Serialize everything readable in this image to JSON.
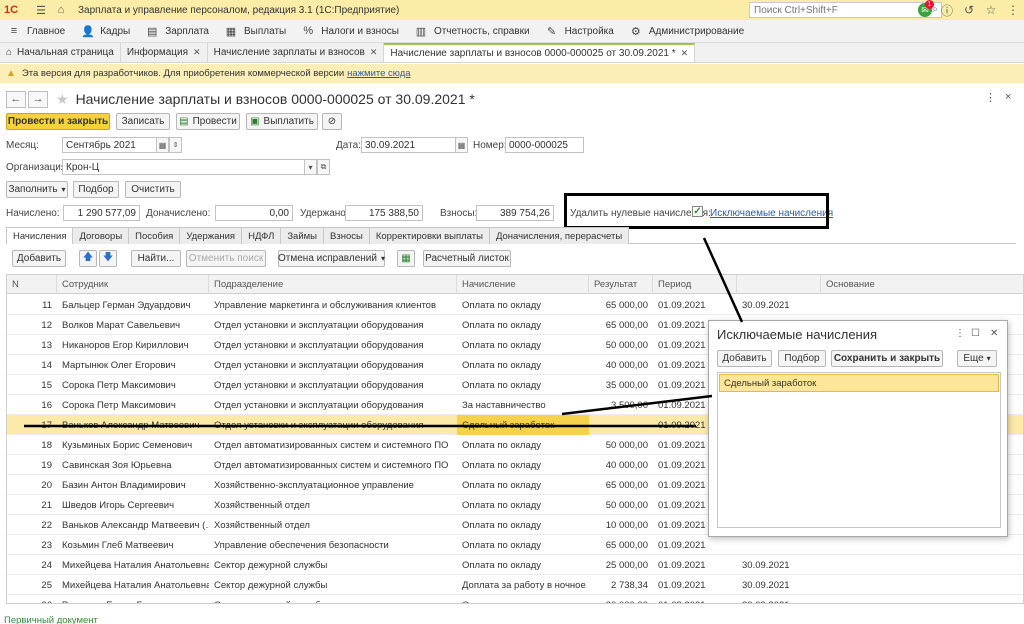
{
  "titlebar": {
    "logo": "1С",
    "app_title": "Зарплата и управление персоналом, редакция 3.1  (1С:Предприятие)",
    "search_placeholder": "Поиск Ctrl+Shift+F",
    "notif_count": "1"
  },
  "main_menu": [
    {
      "icon": "≡",
      "label": "Главное"
    },
    {
      "icon": "👤",
      "label": "Кадры"
    },
    {
      "icon": "▤",
      "label": "Зарплата"
    },
    {
      "icon": "▦",
      "label": "Выплаты"
    },
    {
      "icon": "%",
      "label": "Налоги и взносы"
    },
    {
      "icon": "▥",
      "label": "Отчетность, справки"
    },
    {
      "icon": "✎",
      "label": "Настройка"
    },
    {
      "icon": "⚙",
      "label": "Администрирование"
    }
  ],
  "open_tabs": [
    {
      "label": "Начальная страница"
    },
    {
      "label": "Информация"
    },
    {
      "label": "Начисление зарплаты и взносов"
    },
    {
      "label": "Начисление зарплаты и взносов 0000-000025 от 30.09.2021 *"
    }
  ],
  "banner": {
    "text": "Эта версия для разработчиков. Для приобретения коммерческой версии",
    "link": "нажмите сюда"
  },
  "document": {
    "title": "Начисление зарплаты и взносов 0000-000025 от 30.09.2021 *",
    "more": "⋮",
    "close": "×"
  },
  "toolbar": {
    "post_close": "Провести и закрыть",
    "save": "Записать",
    "post": "Провести",
    "pay": "Выплатить"
  },
  "form": {
    "month_label": "Месяц:",
    "month_value": "Сентябрь 2021",
    "date_label": "Дата:",
    "date_value": "30.09.2021",
    "number_label": "Номер:",
    "number_value": "0000-000025",
    "org_label": "Организация:",
    "org_value": "Крон-Ц",
    "fill_btn": "Заполнить",
    "select_btn": "Подбор",
    "clear_btn": "Очистить"
  },
  "totals": {
    "accrued_label": "Начислено:",
    "accrued_value": "1 290 577,09",
    "extra_label": "Доначислено:",
    "extra_value": "0,00",
    "withheld_label": "Удержано:",
    "withheld_value": "175 388,50",
    "contrib_label": "Взносы:",
    "contrib_value": "389 754,26",
    "delete_zero_label": "Удалить нулевые начисления:",
    "excluded_link": "Исключаемые начисления"
  },
  "section_tabs": [
    "Начисления",
    "Договоры",
    "Пособия",
    "Удержания",
    "НДФЛ",
    "Займы",
    "Взносы",
    "Корректировки выплаты",
    "Доначисления, перерасчеты"
  ],
  "grid_toolbar": {
    "add": "Добавить",
    "find": "Найти...",
    "cancel_find": "Отменить поиск",
    "cancel_fix": "Отмена исправлений",
    "payslip": "Расчетный листок"
  },
  "grid": {
    "columns": [
      "N",
      "Сотрудник",
      "Подразделение",
      "Начисление",
      "Результат",
      "Период",
      "",
      "Основание"
    ],
    "rows": [
      {
        "n": "11",
        "emp": "Бальцер Герман Эдуардович",
        "dept": "Управление маркетинга и обслуживания клиентов",
        "acc": "Оплата по окладу",
        "res": "65 000,00",
        "period": "01.09.2021",
        "end": "30.09.2021"
      },
      {
        "n": "12",
        "emp": "Волков Марат Савельевич",
        "dept": "Отдел установки и эксплуатации оборудования",
        "acc": "Оплата по окладу",
        "res": "65 000,00",
        "period": "01.09.2021",
        "end": ""
      },
      {
        "n": "13",
        "emp": "Никаноров Егор Кириллович",
        "dept": "Отдел установки и эксплуатации оборудования",
        "acc": "Оплата по окладу",
        "res": "50 000,00",
        "period": "01.09.2021",
        "end": ""
      },
      {
        "n": "14",
        "emp": "Мартынюк Олег Егорович",
        "dept": "Отдел установки и эксплуатации оборудования",
        "acc": "Оплата по окладу",
        "res": "40 000,00",
        "period": "01.09.2021",
        "end": ""
      },
      {
        "n": "15",
        "emp": "Сорока Петр Максимович",
        "dept": "Отдел установки и эксплуатации оборудования",
        "acc": "Оплата по окладу",
        "res": "35 000,00",
        "period": "01.09.2021",
        "end": ""
      },
      {
        "n": "16",
        "emp": "Сорока Петр Максимович",
        "dept": "Отдел установки и эксплуатации оборудования",
        "acc": "За наставничество",
        "res": "3 500,00",
        "period": "01.09.2021",
        "end": ""
      },
      {
        "n": "17",
        "emp": "Ваньков Александр Матвеевич",
        "dept": "Отдел установки и эксплуатации оборудования",
        "acc": "Сдельный заработок",
        "res": "",
        "period": "01.09.2021",
        "end": ""
      },
      {
        "n": "18",
        "emp": "Кузьминых Борис Семенович",
        "dept": "Отдел автоматизированных систем и системного ПО",
        "acc": "Оплата по окладу",
        "res": "50 000,00",
        "period": "01.09.2021",
        "end": ""
      },
      {
        "n": "19",
        "emp": "Савинская Зоя Юрьевна",
        "dept": "Отдел автоматизированных систем и системного ПО",
        "acc": "Оплата по окладу",
        "res": "40 000,00",
        "period": "01.09.2021",
        "end": ""
      },
      {
        "n": "20",
        "emp": "Базин Антон Владимирович",
        "dept": "Хозяйственно-эксплуатационное управление",
        "acc": "Оплата по окладу",
        "res": "65 000,00",
        "period": "01.09.2021",
        "end": ""
      },
      {
        "n": "21",
        "emp": "Шведов Игорь Сергеевич",
        "dept": "Хозяйственный отдел",
        "acc": "Оплата по окладу",
        "res": "50 000,00",
        "period": "01.09.2021",
        "end": ""
      },
      {
        "n": "22",
        "emp": "Ваньков Александр Матвеевич (…",
        "dept": "Хозяйственный отдел",
        "acc": "Оплата по окладу",
        "res": "10 000,00",
        "period": "01.09.2021",
        "end": ""
      },
      {
        "n": "23",
        "emp": "Козьмин Глеб Матвеевич",
        "dept": "Управление обеспечения безопасности",
        "acc": "Оплата по окладу",
        "res": "65 000,00",
        "period": "01.09.2021",
        "end": ""
      },
      {
        "n": "24",
        "emp": "Михейцева Наталия Анатольевна",
        "dept": "Сектор дежурной службы",
        "acc": "Оплата по окладу",
        "res": "25 000,00",
        "period": "01.09.2021",
        "end": "30.09.2021"
      },
      {
        "n": "25",
        "emp": "Михейцева Наталия Анатольевна",
        "dept": "Сектор дежурной службы",
        "acc": "Доплата за работу в ночное …",
        "res": "2 738,34",
        "period": "01.09.2021",
        "end": "30.09.2021"
      },
      {
        "n": "26",
        "emp": "Рязанова Елена Борисовна",
        "dept": "Сектор дежурной службы",
        "acc": "Оплата по окладу",
        "res": "30 000,00",
        "period": "01.09.2021",
        "end": "30.09.2021"
      }
    ]
  },
  "popup": {
    "title": "Исключаемые начисления",
    "add": "Добавить",
    "select": "Подбор",
    "save_close": "Сохранить и закрыть",
    "more": "Еще",
    "items": [
      "Сдельный заработок"
    ]
  },
  "status": "Первичный документ"
}
